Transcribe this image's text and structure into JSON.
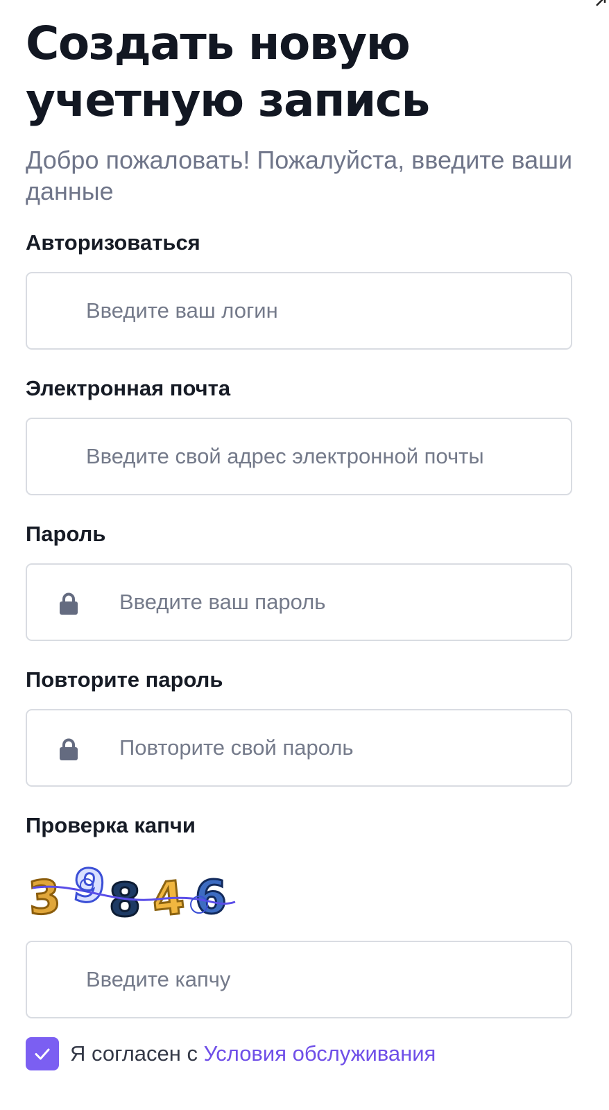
{
  "header": {
    "title": "Создать новую учетную запись",
    "subtitle": "Добро пожаловать! Пожалуйста, введите ваши данные"
  },
  "form": {
    "login": {
      "label": "Авторизоваться",
      "placeholder": "Введите ваш логин"
    },
    "email": {
      "label": "Электронная почта",
      "placeholder": "Введите свой адрес электронной почты"
    },
    "password": {
      "label": "Пароль",
      "placeholder": "Введите ваш пароль",
      "icon": "lock-icon"
    },
    "repeat_password": {
      "label": "Повторите пароль",
      "placeholder": "Повторите свой пароль",
      "icon": "lock-icon"
    },
    "captcha": {
      "label": "Проверка капчи",
      "code": "39846",
      "placeholder": "Введите капчу"
    },
    "terms": {
      "checked": true,
      "text": "Я согласен с ",
      "link_text": "Условия обслуживания"
    }
  },
  "colors": {
    "accent": "#7b5ff2",
    "link": "#6f4fe8",
    "title": "#121722",
    "subtitle": "#6f7589",
    "placeholder": "#747a8a",
    "border": "#d9dce2",
    "icon": "#646b80"
  }
}
